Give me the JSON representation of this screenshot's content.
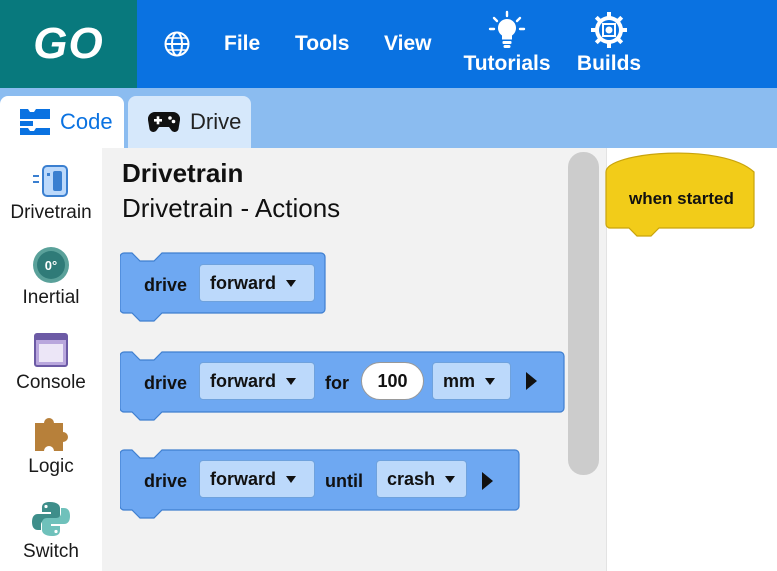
{
  "header": {
    "logo": "GO",
    "menu": {
      "file": "File",
      "tools": "Tools",
      "view": "View"
    },
    "tutorials_label": "Tutorials",
    "builds_label": "Builds"
  },
  "tabs": {
    "code": "Code",
    "drive": "Drive"
  },
  "categories": [
    "Drivetrain",
    "Inertial",
    "Console",
    "Logic",
    "Switch"
  ],
  "inertial_icon_text": "0°",
  "flyout": {
    "title": "Drivetrain",
    "subtitle": "Drivetrain - Actions",
    "block1": {
      "label": "drive",
      "direction": "forward"
    },
    "block2": {
      "label": "drive",
      "direction": "forward",
      "for_label": "for",
      "amount": "100",
      "unit": "mm"
    },
    "block3": {
      "label": "drive",
      "direction": "forward",
      "until_label": "until",
      "condition": "crash"
    }
  },
  "workspace": {
    "hat_label": "when started"
  },
  "colors": {
    "topbar": "#0a72e1",
    "logo_bg": "#08797d",
    "tabstrip": "#8bbcf0",
    "block_fill": "#6ea8f2",
    "block_stroke": "#3f7fd0",
    "hat_fill": "#f2cc19"
  }
}
